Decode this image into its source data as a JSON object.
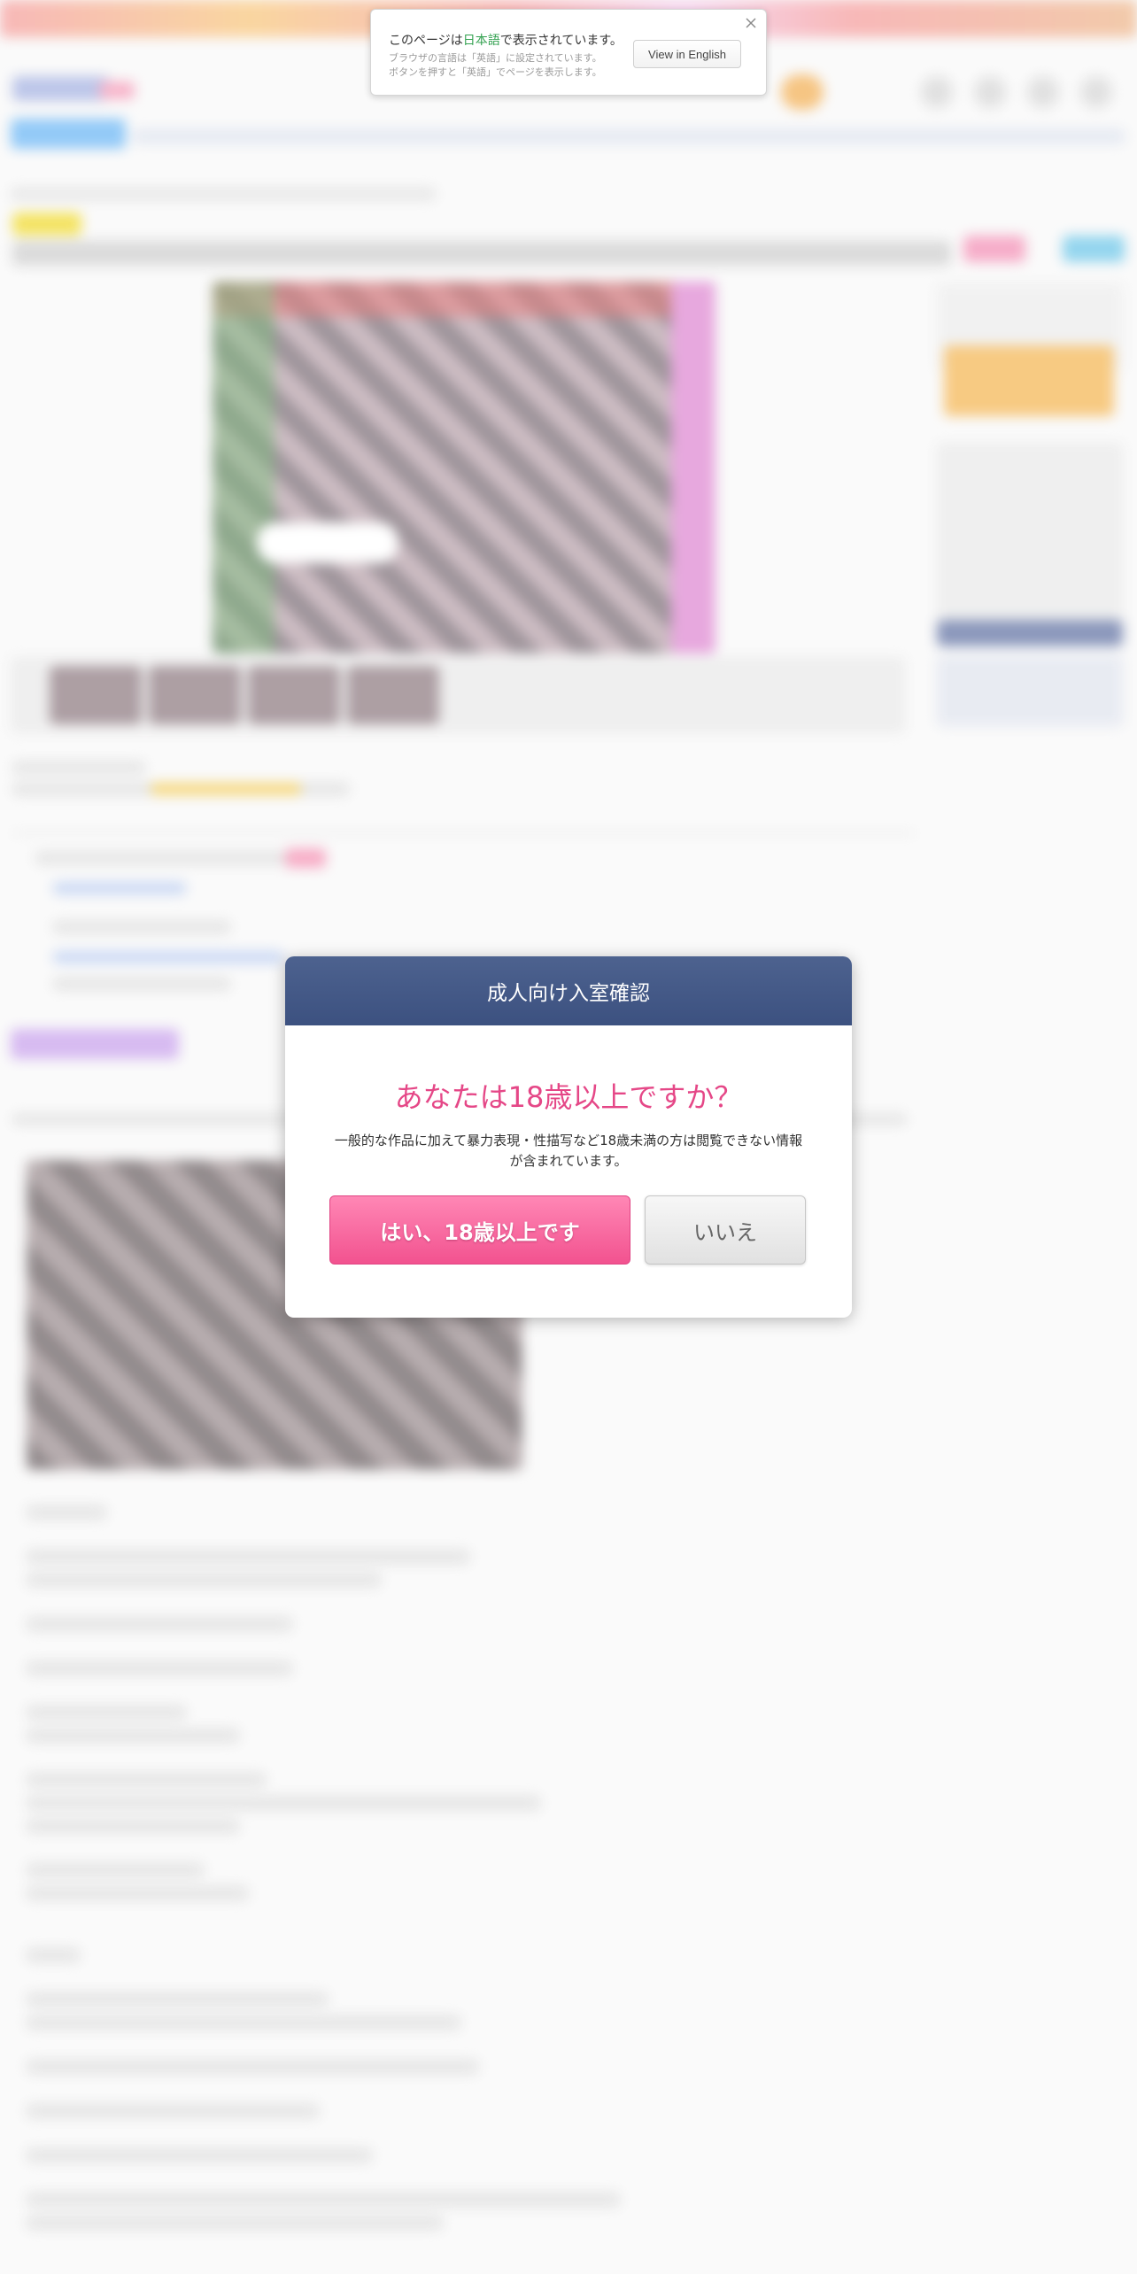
{
  "language_notice": {
    "message_prefix": "このページは",
    "message_language": "日本語",
    "message_suffix": "で表示されています。",
    "sub_line1": "ブラウザの言語は「英語」に設定されています。",
    "sub_line2": "ボタンを押すと「英語」でページを表示します。",
    "button_label": "View in English",
    "close_icon": "close-icon",
    "highlight_color": "#33a150"
  },
  "age_check": {
    "title": "成人向け入室確認",
    "question": "あなたは18歳以上ですか？",
    "description": "一般的な作品に加えて暴力表現・性描写など18歳未満の方は閲覧できない情報が含まれています。",
    "yes_label": "はい、18歳以上です",
    "no_label": "いいえ",
    "header_color": "#44598a",
    "question_color": "#e54787",
    "yes_color": "#f5609a"
  }
}
